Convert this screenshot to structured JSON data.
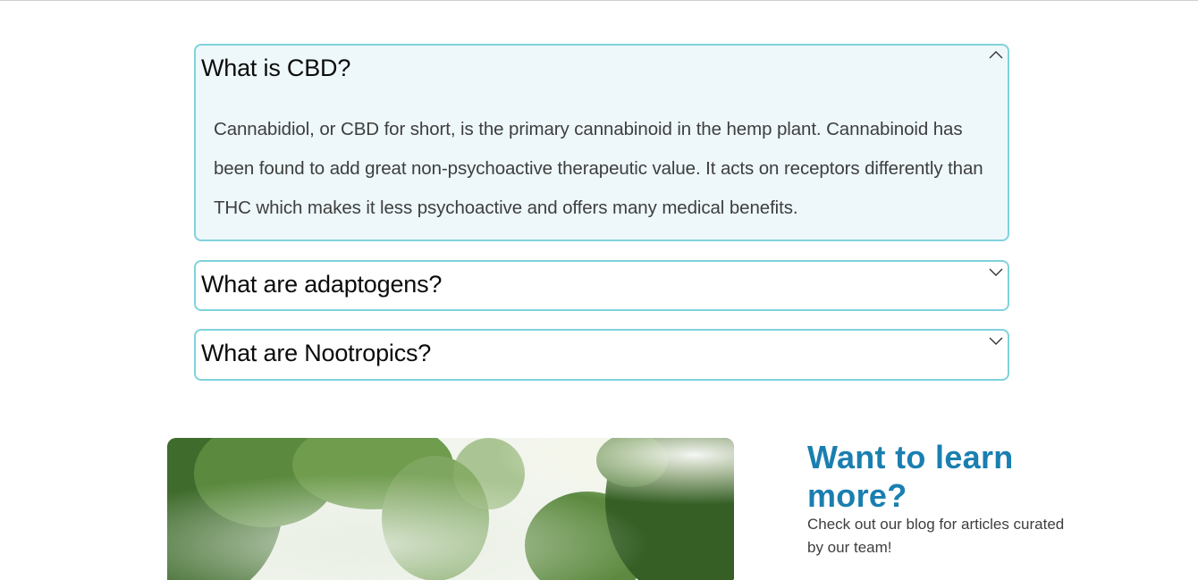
{
  "faq": {
    "items": [
      {
        "question": "What is CBD?",
        "answer": "Cannabidiol, or CBD for short, is the primary cannabinoid in the hemp plant. Cannabinoid has been found to add great non-psychoactive therapeutic value. It acts on receptors differently than THC which makes it less psychoactive and offers many medical benefits.",
        "expanded": true,
        "icon": "chevron-up-icon"
      },
      {
        "question": "What are adaptogens?",
        "expanded": false,
        "icon": "chevron-down-icon"
      },
      {
        "question": "What are Nootropics?",
        "expanded": false,
        "icon": "chevron-down-icon"
      }
    ],
    "border_color": "#80d2dc",
    "open_background": "#eef8fb"
  },
  "learn_more": {
    "title": "Want to learn more?",
    "text": "Check out our blog for articles curated by our team!",
    "title_color": "#1a7fb0",
    "image": "forest-path-image"
  }
}
